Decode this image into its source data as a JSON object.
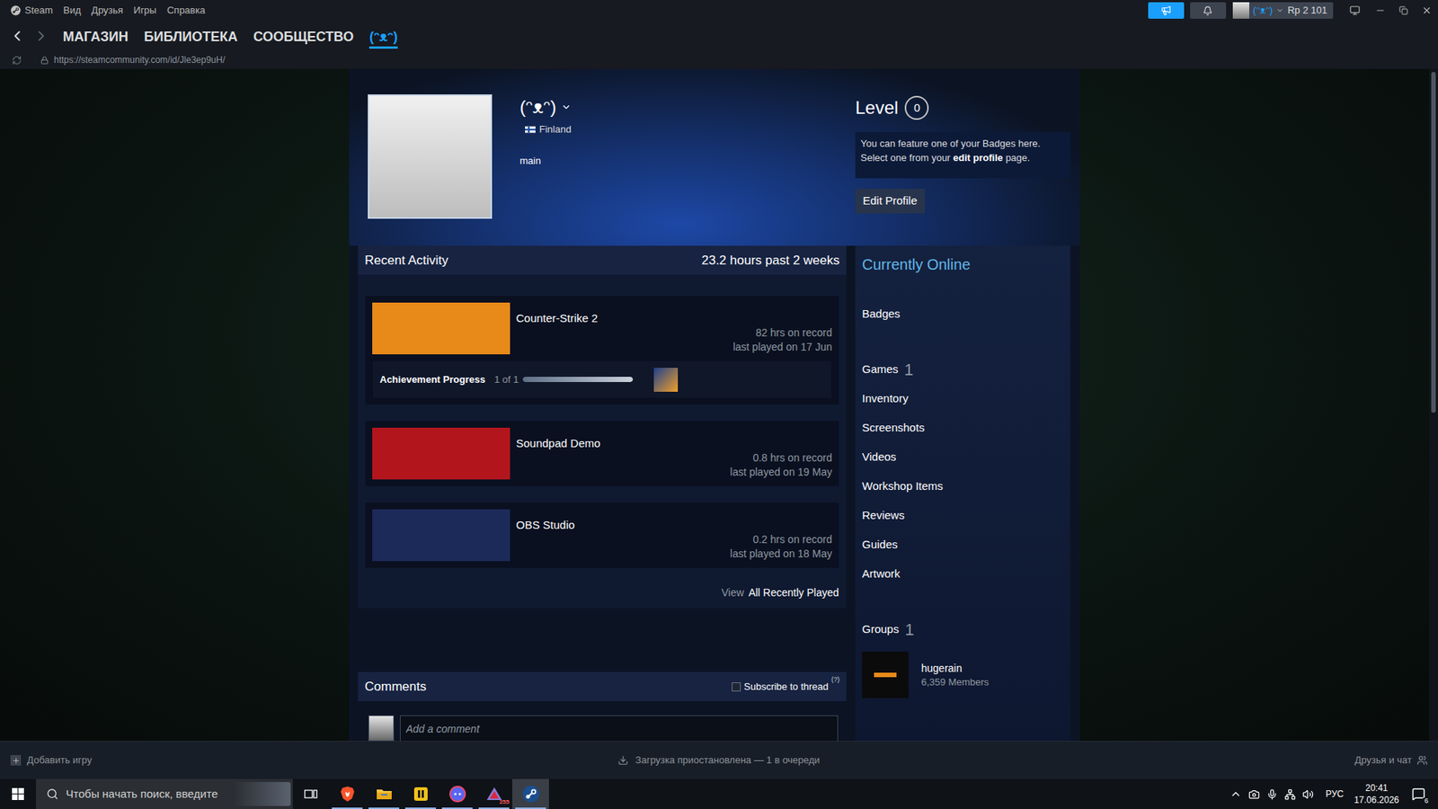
{
  "titlebar": {
    "menu": [
      "Steam",
      "Вид",
      "Друзья",
      "Игры",
      "Справка"
    ],
    "account": {
      "name": "(ᵔᴥᵔ)",
      "balance": "Rp 2 101"
    }
  },
  "nav": {
    "tabs": [
      {
        "label": "МАГАЗИН",
        "selected": false
      },
      {
        "label": "БИБЛИОТЕКА",
        "selected": false
      },
      {
        "label": "СООБЩЕСТВО",
        "selected": false
      },
      {
        "label": "(ᵔᴥᵔ)",
        "selected": true
      }
    ],
    "url": "https://steamcommunity.com/id/Jle3ep9uH/"
  },
  "profile": {
    "name": "(ᵔᴥᵔ)",
    "country": "Finland",
    "summary": "main",
    "level_label": "Level",
    "level": "0",
    "badge_hint": {
      "text": "You can feature one of your Badges here. Select one from your ",
      "link": "edit profile",
      "end": " page."
    },
    "edit_button": "Edit Profile"
  },
  "activity": {
    "title": "Recent Activity",
    "hours": "23.2 hours past 2 weeks",
    "games": [
      {
        "name": "Counter-Strike 2",
        "hours": "82 hrs on record",
        "last_played": "last played on 17 Jun",
        "color": "#e88a1a",
        "kind": "achievements",
        "achievements": {
          "label": "Achievement Progress",
          "count": "1 of 1",
          "level": 1
        }
      },
      {
        "name": "Soundpad Demo",
        "hours": "0.8 hrs on record",
        "last_played": "last played on 19 May",
        "color": "#b3151d",
        "kind": "plain"
      },
      {
        "name": "OBS Studio",
        "hours": "0.2 hrs on record",
        "last_played": "last played on 18 May",
        "color": "#1c2a5a",
        "kind": "plain"
      }
    ],
    "view_label": "View",
    "view_link": "All Recently Played"
  },
  "comments": {
    "title": "Comments",
    "subscribe": {
      "label": "Subscribe to thread",
      "checked": false,
      "help": "(?)"
    },
    "placeholder": "Add a comment"
  },
  "sidebar": {
    "status": "Currently Online",
    "items": [
      {
        "label": "Badges",
        "count": "",
        "kind": "section"
      },
      {
        "label": "Games",
        "count": "1",
        "kind": "section"
      },
      {
        "label": "Inventory",
        "count": "",
        "kind": "link"
      },
      {
        "label": "Screenshots",
        "count": "",
        "kind": "link"
      },
      {
        "label": "Videos",
        "count": "",
        "kind": "link"
      },
      {
        "label": "Workshop Items",
        "count": "",
        "kind": "link"
      },
      {
        "label": "Reviews",
        "count": "",
        "kind": "link"
      },
      {
        "label": "Guides",
        "count": "",
        "kind": "link"
      },
      {
        "label": "Artwork",
        "count": "",
        "kind": "link"
      }
    ],
    "groups": {
      "label": "Groups",
      "count": "1",
      "items": [
        {
          "name": "hugerain",
          "members": "6,359 Members"
        }
      ]
    }
  },
  "scrollbar": {
    "level": 0.51
  },
  "bottom_bar": {
    "add_game": "Добавить игру",
    "downloads": "Загрузка приостановлена — 1 в очереди",
    "friends": "Друзья и чат"
  },
  "taskbar": {
    "search_placeholder": "Чтобы начать поиск, введите",
    "apps": [
      {
        "running": true,
        "selected": false,
        "badge": ""
      },
      {
        "running": true,
        "selected": false,
        "badge": ""
      },
      {
        "running": true,
        "selected": false,
        "badge": ""
      },
      {
        "running": true,
        "selected": false,
        "badge": ""
      },
      {
        "running": true,
        "selected": false,
        "badge": "255"
      },
      {
        "running": true,
        "selected": true,
        "badge": ""
      }
    ],
    "tray": {
      "language": "РУС",
      "time": "20:41",
      "date": "17.06.2026",
      "notifications": "6"
    }
  }
}
